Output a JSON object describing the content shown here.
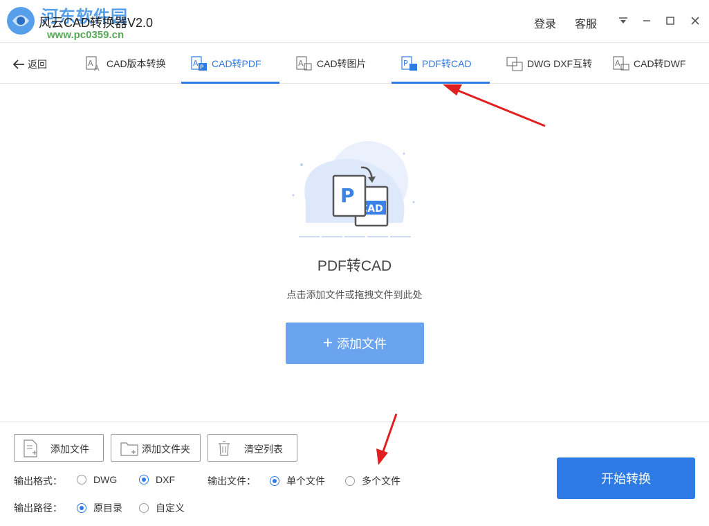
{
  "window": {
    "title": "风云CAD转换器V2.0",
    "watermark": "河东软件园",
    "watermark_url": "www.pc0359.cn",
    "login": "登录",
    "support": "客服"
  },
  "nav": {
    "back": "返回",
    "tabs": [
      {
        "label": "CAD版本转换",
        "active": false
      },
      {
        "label": "CAD转PDF",
        "active": true
      },
      {
        "label": "CAD转图片",
        "active": false
      },
      {
        "label": "PDF转CAD",
        "active": true
      },
      {
        "label": "DWG DXF互转",
        "active": false
      },
      {
        "label": "CAD转DWF",
        "active": false
      }
    ]
  },
  "main": {
    "title": "PDF转CAD",
    "hint": "点击添加文件或拖拽文件到此处",
    "add_button": "添加文件",
    "illustration_text_p": "P",
    "illustration_text_cad": "CAD"
  },
  "toolbar": {
    "add_file": "添加文件",
    "add_folder": "添加文件夹",
    "clear_list": "清空列表"
  },
  "options": {
    "format_label": "输出格式：",
    "format_choices": [
      {
        "label": "DWG",
        "selected": false
      },
      {
        "label": "DXF",
        "selected": true
      }
    ],
    "file_label": "输出文件：",
    "file_choices": [
      {
        "label": "单个文件",
        "selected": true
      },
      {
        "label": "多个文件",
        "selected": false
      }
    ],
    "path_label": "输出路径：",
    "path_choices": [
      {
        "label": "原目录",
        "selected": true
      },
      {
        "label": "自定义",
        "selected": false
      }
    ]
  },
  "start_button": "开始转换",
  "colors": {
    "accent": "#2e7be6",
    "add_button": "#6aa3ee",
    "arrow": "#e02020"
  }
}
